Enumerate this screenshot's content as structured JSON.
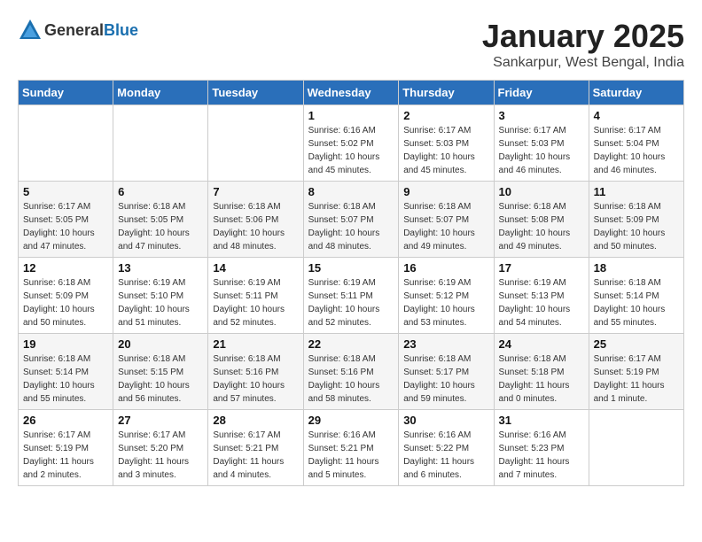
{
  "header": {
    "logo_general": "General",
    "logo_blue": "Blue",
    "month_year": "January 2025",
    "location": "Sankarpur, West Bengal, India"
  },
  "weekdays": [
    "Sunday",
    "Monday",
    "Tuesday",
    "Wednesday",
    "Thursday",
    "Friday",
    "Saturday"
  ],
  "weeks": [
    [
      {
        "day": "",
        "info": ""
      },
      {
        "day": "",
        "info": ""
      },
      {
        "day": "",
        "info": ""
      },
      {
        "day": "1",
        "info": "Sunrise: 6:16 AM\nSunset: 5:02 PM\nDaylight: 10 hours\nand 45 minutes."
      },
      {
        "day": "2",
        "info": "Sunrise: 6:17 AM\nSunset: 5:03 PM\nDaylight: 10 hours\nand 45 minutes."
      },
      {
        "day": "3",
        "info": "Sunrise: 6:17 AM\nSunset: 5:03 PM\nDaylight: 10 hours\nand 46 minutes."
      },
      {
        "day": "4",
        "info": "Sunrise: 6:17 AM\nSunset: 5:04 PM\nDaylight: 10 hours\nand 46 minutes."
      }
    ],
    [
      {
        "day": "5",
        "info": "Sunrise: 6:17 AM\nSunset: 5:05 PM\nDaylight: 10 hours\nand 47 minutes."
      },
      {
        "day": "6",
        "info": "Sunrise: 6:18 AM\nSunset: 5:05 PM\nDaylight: 10 hours\nand 47 minutes."
      },
      {
        "day": "7",
        "info": "Sunrise: 6:18 AM\nSunset: 5:06 PM\nDaylight: 10 hours\nand 48 minutes."
      },
      {
        "day": "8",
        "info": "Sunrise: 6:18 AM\nSunset: 5:07 PM\nDaylight: 10 hours\nand 48 minutes."
      },
      {
        "day": "9",
        "info": "Sunrise: 6:18 AM\nSunset: 5:07 PM\nDaylight: 10 hours\nand 49 minutes."
      },
      {
        "day": "10",
        "info": "Sunrise: 6:18 AM\nSunset: 5:08 PM\nDaylight: 10 hours\nand 49 minutes."
      },
      {
        "day": "11",
        "info": "Sunrise: 6:18 AM\nSunset: 5:09 PM\nDaylight: 10 hours\nand 50 minutes."
      }
    ],
    [
      {
        "day": "12",
        "info": "Sunrise: 6:18 AM\nSunset: 5:09 PM\nDaylight: 10 hours\nand 50 minutes."
      },
      {
        "day": "13",
        "info": "Sunrise: 6:19 AM\nSunset: 5:10 PM\nDaylight: 10 hours\nand 51 minutes."
      },
      {
        "day": "14",
        "info": "Sunrise: 6:19 AM\nSunset: 5:11 PM\nDaylight: 10 hours\nand 52 minutes."
      },
      {
        "day": "15",
        "info": "Sunrise: 6:19 AM\nSunset: 5:11 PM\nDaylight: 10 hours\nand 52 minutes."
      },
      {
        "day": "16",
        "info": "Sunrise: 6:19 AM\nSunset: 5:12 PM\nDaylight: 10 hours\nand 53 minutes."
      },
      {
        "day": "17",
        "info": "Sunrise: 6:19 AM\nSunset: 5:13 PM\nDaylight: 10 hours\nand 54 minutes."
      },
      {
        "day": "18",
        "info": "Sunrise: 6:18 AM\nSunset: 5:14 PM\nDaylight: 10 hours\nand 55 minutes."
      }
    ],
    [
      {
        "day": "19",
        "info": "Sunrise: 6:18 AM\nSunset: 5:14 PM\nDaylight: 10 hours\nand 55 minutes."
      },
      {
        "day": "20",
        "info": "Sunrise: 6:18 AM\nSunset: 5:15 PM\nDaylight: 10 hours\nand 56 minutes."
      },
      {
        "day": "21",
        "info": "Sunrise: 6:18 AM\nSunset: 5:16 PM\nDaylight: 10 hours\nand 57 minutes."
      },
      {
        "day": "22",
        "info": "Sunrise: 6:18 AM\nSunset: 5:16 PM\nDaylight: 10 hours\nand 58 minutes."
      },
      {
        "day": "23",
        "info": "Sunrise: 6:18 AM\nSunset: 5:17 PM\nDaylight: 10 hours\nand 59 minutes."
      },
      {
        "day": "24",
        "info": "Sunrise: 6:18 AM\nSunset: 5:18 PM\nDaylight: 11 hours\nand 0 minutes."
      },
      {
        "day": "25",
        "info": "Sunrise: 6:17 AM\nSunset: 5:19 PM\nDaylight: 11 hours\nand 1 minute."
      }
    ],
    [
      {
        "day": "26",
        "info": "Sunrise: 6:17 AM\nSunset: 5:19 PM\nDaylight: 11 hours\nand 2 minutes."
      },
      {
        "day": "27",
        "info": "Sunrise: 6:17 AM\nSunset: 5:20 PM\nDaylight: 11 hours\nand 3 minutes."
      },
      {
        "day": "28",
        "info": "Sunrise: 6:17 AM\nSunset: 5:21 PM\nDaylight: 11 hours\nand 4 minutes."
      },
      {
        "day": "29",
        "info": "Sunrise: 6:16 AM\nSunset: 5:21 PM\nDaylight: 11 hours\nand 5 minutes."
      },
      {
        "day": "30",
        "info": "Sunrise: 6:16 AM\nSunset: 5:22 PM\nDaylight: 11 hours\nand 6 minutes."
      },
      {
        "day": "31",
        "info": "Sunrise: 6:16 AM\nSunset: 5:23 PM\nDaylight: 11 hours\nand 7 minutes."
      },
      {
        "day": "",
        "info": ""
      }
    ]
  ]
}
